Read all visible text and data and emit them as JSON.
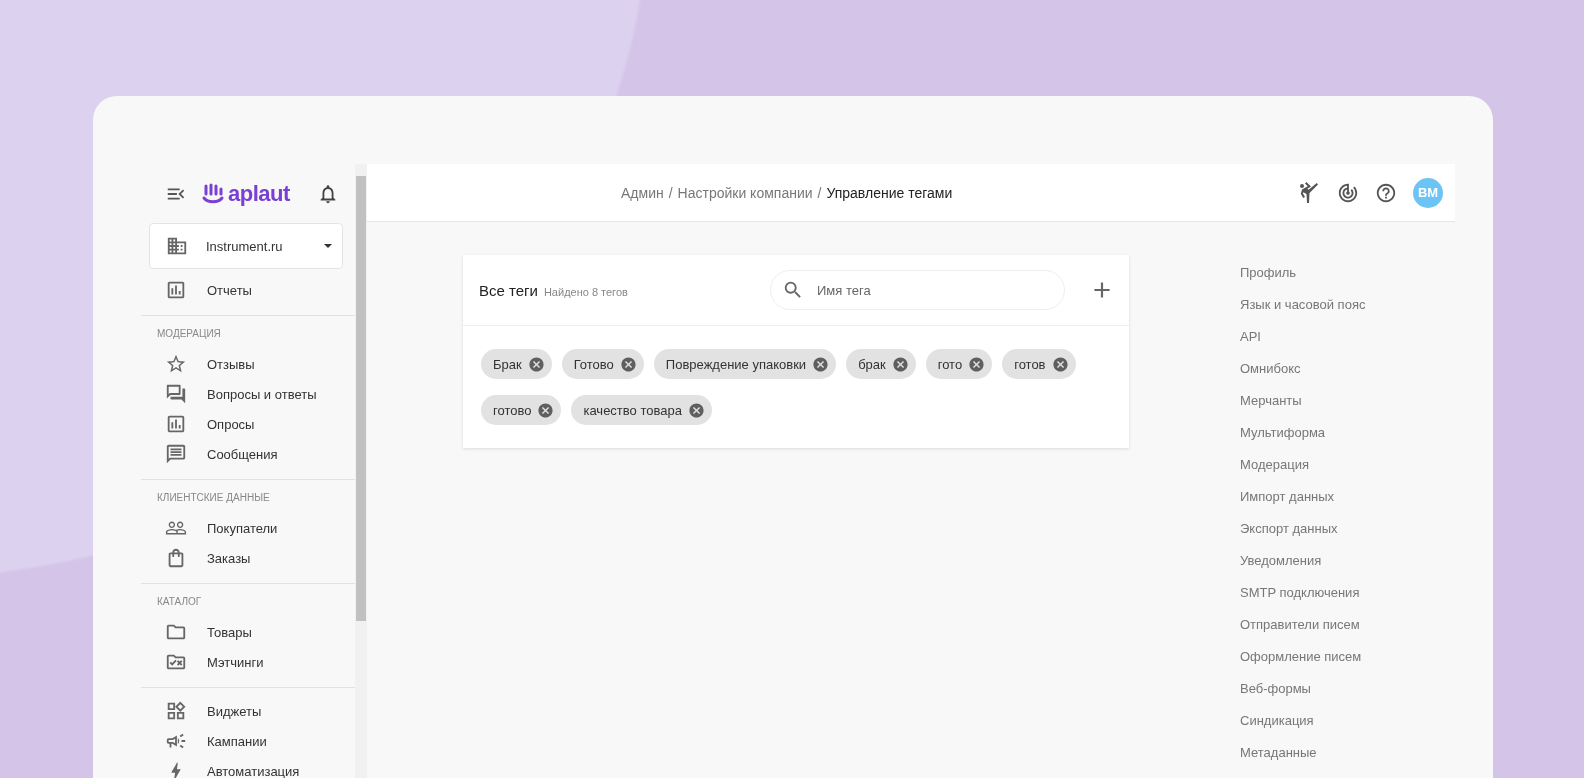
{
  "sidebar": {
    "logo": "aplaut",
    "company": "Instrument.ru",
    "top_items": [
      {
        "label": "Отчеты"
      }
    ],
    "sections": [
      {
        "title": "МОДЕРАЦИЯ",
        "items": [
          {
            "label": "Отзывы"
          },
          {
            "label": "Вопросы и ответы"
          },
          {
            "label": "Опросы"
          },
          {
            "label": "Сообщения"
          }
        ]
      },
      {
        "title": "КЛИЕНТСКИЕ ДАННЫЕ",
        "items": [
          {
            "label": "Покупатели"
          },
          {
            "label": "Заказы"
          }
        ]
      },
      {
        "title": "КАТАЛОГ",
        "items": [
          {
            "label": "Товары"
          },
          {
            "label": "Мэтчинги"
          }
        ]
      },
      {
        "items": [
          {
            "label": "Виджеты"
          },
          {
            "label": "Кампании"
          },
          {
            "label": "Автоматизация"
          }
        ]
      }
    ]
  },
  "breadcrumb": [
    {
      "label": "Админ",
      "current": false
    },
    {
      "separator": "/",
      "label": "Настройки компании",
      "current": false
    },
    {
      "separator": "/",
      "label": "Управление тегами",
      "current": true
    }
  ],
  "header": {
    "avatar": "BM"
  },
  "tags_card": {
    "title": "Все теги",
    "count": "Найдено 8 тегов",
    "search": {
      "placeholder": "Имя тега"
    },
    "tags": [
      "Брак",
      "Готово",
      "Повреждение упаковки",
      "брак",
      "гото",
      "готов",
      "готово",
      "качество товара"
    ]
  },
  "settings_menu": [
    "Профиль",
    "Язык и часовой пояс",
    "API",
    "Омнибокс",
    "Мерчанты",
    "Мультиформа",
    "Модерация",
    "Импорт данных",
    "Экспорт данных",
    "Уведомления",
    "SMTP подключения",
    "Отправители писем",
    "Оформление писем",
    "Веб-формы",
    "Синдикация",
    "Метаданные"
  ]
}
